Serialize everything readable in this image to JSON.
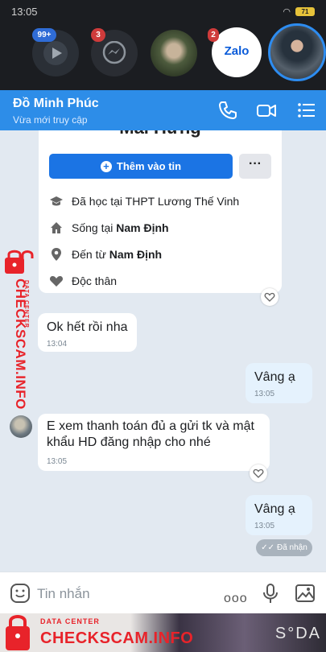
{
  "status_bar": {
    "time": "13:05",
    "battery": "71"
  },
  "chat_heads": {
    "video_badge": "99+",
    "messenger_badge": "3",
    "photo_badge": "2",
    "zalo_label": "Zalo"
  },
  "header": {
    "name": "Đồ Minh Phúc",
    "status": "Vừa mới truy cập"
  },
  "profile_card": {
    "name": "Mai Hưng",
    "add_story": "Thêm vào tin",
    "more": "···",
    "study": "Đã học tại THPT Lương Thế Vinh",
    "lives_prefix": "Sống tại ",
    "lives_place": "Nam Định",
    "from_prefix": "Đến từ ",
    "from_place": "Nam Định",
    "relationship": "Độc thân"
  },
  "messages": [
    {
      "text": "Ok hết rồi nha",
      "time": "13:04"
    },
    {
      "text": "Vâng ạ",
      "time": "13:05"
    },
    {
      "text": "E xem thanh toán đủ a gửi tk và mật khẩu HD đăng nhập cho nhé",
      "time": "13:05"
    },
    {
      "text": "Vâng ạ",
      "time": "13:05"
    }
  ],
  "delivered": "Đã nhận",
  "input": {
    "placeholder": "Tin nhắn",
    "more": "ooo"
  },
  "watermark": {
    "brand": "CHECKSCAM.INFO",
    "sub": "DATA CENTER"
  },
  "banner": {
    "sub": "DATA CENTER",
    "brand": "CHECKSCAM.INFO",
    "corner": "S°DA"
  },
  "colors": {
    "header": "#2d8de8",
    "outgoing": "#e5f2fd",
    "watermark": "#e8232a",
    "button": "#1b74e4"
  }
}
